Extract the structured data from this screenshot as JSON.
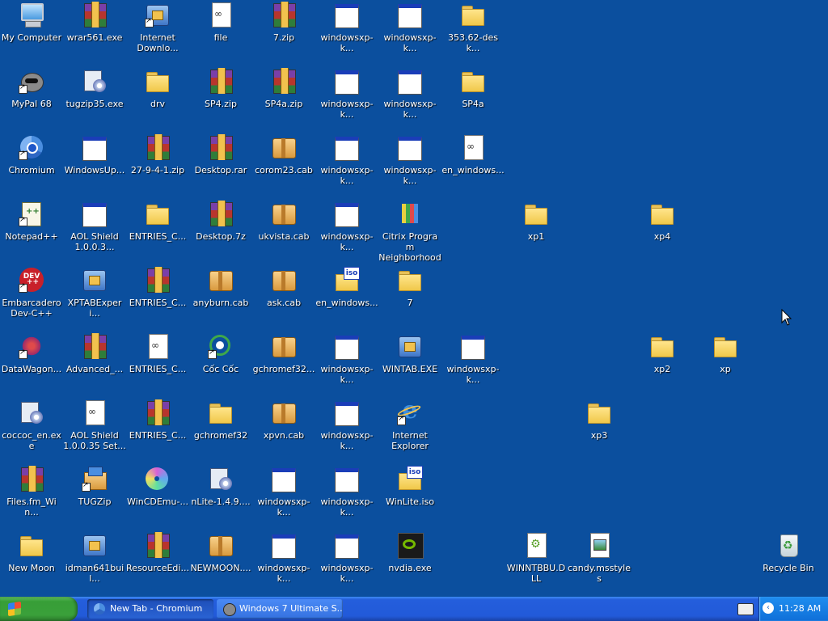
{
  "desktop": {
    "icons": [
      {
        "label": "My Computer",
        "type": "computer",
        "shortcut": false
      },
      {
        "label": "wrar561.exe",
        "type": "rar",
        "shortcut": false
      },
      {
        "label": "Internet\nDownlo...",
        "type": "app",
        "shortcut": true
      },
      {
        "label": "file",
        "type": "doc",
        "shortcut": false
      },
      {
        "label": "7.zip",
        "type": "rar",
        "shortcut": false
      },
      {
        "label": "windowsxp-k...",
        "type": "window",
        "shortcut": false
      },
      {
        "label": "windowsxp-k...",
        "type": "window",
        "shortcut": false
      },
      {
        "label": "353.62-desk...",
        "type": "folder",
        "shortcut": false
      },
      {
        "label": "MyPal 68",
        "type": "raccoon",
        "shortcut": true
      },
      {
        "label": "tugzip35.exe",
        "type": "setup",
        "shortcut": false
      },
      {
        "label": "drv",
        "type": "folder",
        "shortcut": false
      },
      {
        "label": "SP4.zip",
        "type": "rar",
        "shortcut": false
      },
      {
        "label": "SP4a.zip",
        "type": "rar",
        "shortcut": false
      },
      {
        "label": "windowsxp-k...",
        "type": "window",
        "shortcut": false
      },
      {
        "label": "windowsxp-k...",
        "type": "window",
        "shortcut": false
      },
      {
        "label": "SP4a",
        "type": "folder",
        "shortcut": false
      },
      {
        "label": "Chromium",
        "type": "chromium",
        "shortcut": true
      },
      {
        "label": "WindowsUp...",
        "type": "window",
        "shortcut": false
      },
      {
        "label": "27-9-4-1.zip",
        "type": "rar",
        "shortcut": false
      },
      {
        "label": "Desktop.rar",
        "type": "rar",
        "shortcut": false
      },
      {
        "label": "corom23.cab",
        "type": "cab",
        "shortcut": false
      },
      {
        "label": "windowsxp-k...",
        "type": "window",
        "shortcut": false
      },
      {
        "label": "windowsxp-k...",
        "type": "window",
        "shortcut": false
      },
      {
        "label": "en_windows...",
        "type": "doc",
        "shortcut": false
      },
      {
        "label": "Notepad++",
        "type": "notepad",
        "shortcut": true
      },
      {
        "label": "AOL Shield\n1.0.0.3...",
        "type": "window",
        "shortcut": false
      },
      {
        "label": "ENTRIES_C...",
        "type": "folder",
        "shortcut": false
      },
      {
        "label": "Desktop.7z",
        "type": "rar",
        "shortcut": false
      },
      {
        "label": "ukvista.cab",
        "type": "cab",
        "shortcut": false
      },
      {
        "label": "windowsxp-k...",
        "type": "window",
        "shortcut": false
      },
      {
        "label": "Citrix Program\nNeighborhood",
        "type": "citrix",
        "shortcut": false
      },
      {
        "label": "xp1",
        "type": "folder",
        "shortcut": false
      },
      {
        "label": "xp4",
        "type": "folder",
        "shortcut": false
      },
      {
        "label": "Embarcadero\nDev-C++",
        "type": "dev",
        "shortcut": true
      },
      {
        "label": "XPTABExperi...",
        "type": "app",
        "shortcut": false
      },
      {
        "label": "ENTRIES_C...",
        "type": "rar",
        "shortcut": false
      },
      {
        "label": "anyburn.cab",
        "type": "cab",
        "shortcut": false
      },
      {
        "label": "ask.cab",
        "type": "cab",
        "shortcut": false
      },
      {
        "label": "en_windows...",
        "type": "iso",
        "shortcut": false
      },
      {
        "label": "7",
        "type": "folder",
        "shortcut": false
      },
      {
        "label": "DataWagon...",
        "type": "datawagon",
        "shortcut": true
      },
      {
        "label": "Advanced_...",
        "type": "rar",
        "shortcut": false
      },
      {
        "label": "ENTRIES_C...",
        "type": "doc",
        "shortcut": false
      },
      {
        "label": "Cốc Cốc",
        "type": "coccoc",
        "shortcut": true
      },
      {
        "label": "gchromef32...",
        "type": "cab",
        "shortcut": false
      },
      {
        "label": "windowsxp-k...",
        "type": "window",
        "shortcut": false
      },
      {
        "label": "WINTAB.EXE",
        "type": "app",
        "shortcut": false
      },
      {
        "label": "windowsxp-k...",
        "type": "window",
        "shortcut": false
      },
      {
        "label": "xp2",
        "type": "folder",
        "shortcut": false
      },
      {
        "label": "xp",
        "type": "folder",
        "shortcut": false
      },
      {
        "label": "coccoc_en.exe",
        "type": "setup",
        "shortcut": false
      },
      {
        "label": "AOL Shield\n1.0.0.35 Set...",
        "type": "doc",
        "shortcut": false
      },
      {
        "label": "ENTRIES_C...",
        "type": "rar",
        "shortcut": false
      },
      {
        "label": "gchromef32",
        "type": "folder",
        "shortcut": false
      },
      {
        "label": "xpvn.cab",
        "type": "cab",
        "shortcut": false
      },
      {
        "label": "windowsxp-k...",
        "type": "window",
        "shortcut": false
      },
      {
        "label": "Internet\nExplorer",
        "type": "ie",
        "shortcut": true
      },
      {
        "label": "xp3",
        "type": "folder",
        "shortcut": false
      },
      {
        "label": "Files.fm_Win...",
        "type": "rar",
        "shortcut": false
      },
      {
        "label": "TUGZip",
        "type": "tugzip",
        "shortcut": true
      },
      {
        "label": "WinCDEmu-...",
        "type": "cd",
        "shortcut": false
      },
      {
        "label": "nLite-1.4.9....",
        "type": "setup",
        "shortcut": false
      },
      {
        "label": "windowsxp-k...",
        "type": "window",
        "shortcut": false
      },
      {
        "label": "windowsxp-k...",
        "type": "window",
        "shortcut": false
      },
      {
        "label": "WinLite.iso",
        "type": "iso",
        "shortcut": false
      },
      {
        "label": "New Moon",
        "type": "folder",
        "shortcut": false
      },
      {
        "label": "idman641buil...",
        "type": "app",
        "shortcut": false
      },
      {
        "label": "ResourceEdi...",
        "type": "rar",
        "shortcut": false
      },
      {
        "label": "NEWMOON....",
        "type": "cab",
        "shortcut": false
      },
      {
        "label": "windowsxp-k...",
        "type": "window",
        "shortcut": false
      },
      {
        "label": "windowsxp-k...",
        "type": "window",
        "shortcut": false
      },
      {
        "label": "nvdia.exe",
        "type": "nvidia",
        "shortcut": false
      },
      {
        "label": "WINNTBBU.DLL",
        "type": "dll",
        "shortcut": false
      },
      {
        "label": "candy.msstyles",
        "type": "msstyles",
        "shortcut": false
      },
      {
        "label": "Recycle Bin",
        "type": "recycle",
        "shortcut": false
      }
    ]
  },
  "taskbar": {
    "start_label": "",
    "tasks": [
      {
        "label": "New Tab - Chromium",
        "icon": "chromium-icon",
        "active": true
      },
      {
        "label": "Windows 7 Ultimate S...",
        "icon": "mypal-icon",
        "active": false
      }
    ],
    "tray_icon": "keyboard-icon",
    "clock": "11:28 AM"
  },
  "colors": {
    "desktop_background": "#0B4F9E",
    "taskbar": "#245EDC",
    "start_button": "#3AA03A",
    "tray": "#0F6FD8"
  }
}
